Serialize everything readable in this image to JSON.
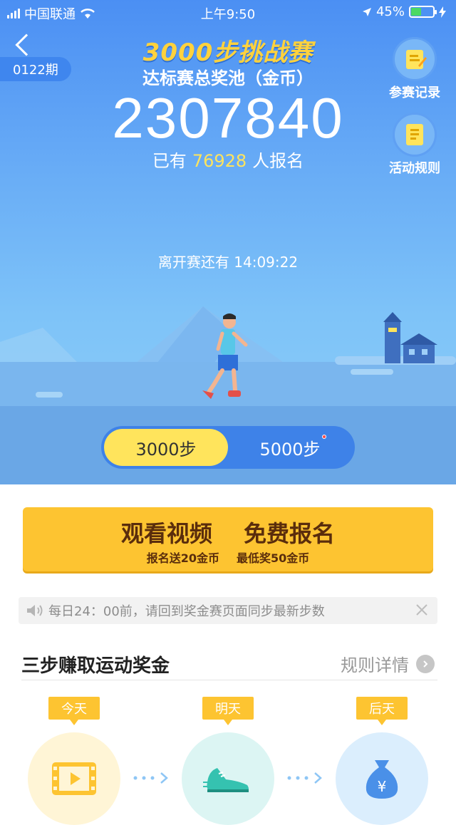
{
  "status_bar": {
    "carrier": "中国联通",
    "time": "上午9:50",
    "battery": "45%"
  },
  "header": {
    "period": "0122期",
    "title": "3000步挑战赛",
    "subtitle": "达标赛总奖池（金币）",
    "pool_amount": "2307840",
    "registered_prefix": "已有",
    "registered_count": "76928",
    "registered_suffix": "人报名"
  },
  "side_buttons": {
    "records": "参赛记录",
    "rules": "活动规则"
  },
  "countdown": "离开赛还有 14:09:22",
  "tabs": [
    {
      "label": "3000步",
      "active": true
    },
    {
      "label": "5000步",
      "active": false,
      "has_dot": true
    }
  ],
  "cta": {
    "main_left": "观看视频",
    "main_right": "免费报名",
    "sub_left": "报名送20金币",
    "sub_right": "最低奖50金币"
  },
  "notice": {
    "text": "每日24：00前，请回到奖金赛页面同步最新步数"
  },
  "section": {
    "title": "三步赚取运动奖金",
    "link": "规则详情"
  },
  "steps": [
    {
      "tag": "今天",
      "icon": "video-icon"
    },
    {
      "tag": "明天",
      "icon": "sneaker-icon"
    },
    {
      "tag": "后天",
      "icon": "money-bag-icon"
    }
  ],
  "colors": {
    "accent_yellow": "#fdc431",
    "hero_blue": "#4b8ff3",
    "count_yellow": "#ffe45c"
  }
}
